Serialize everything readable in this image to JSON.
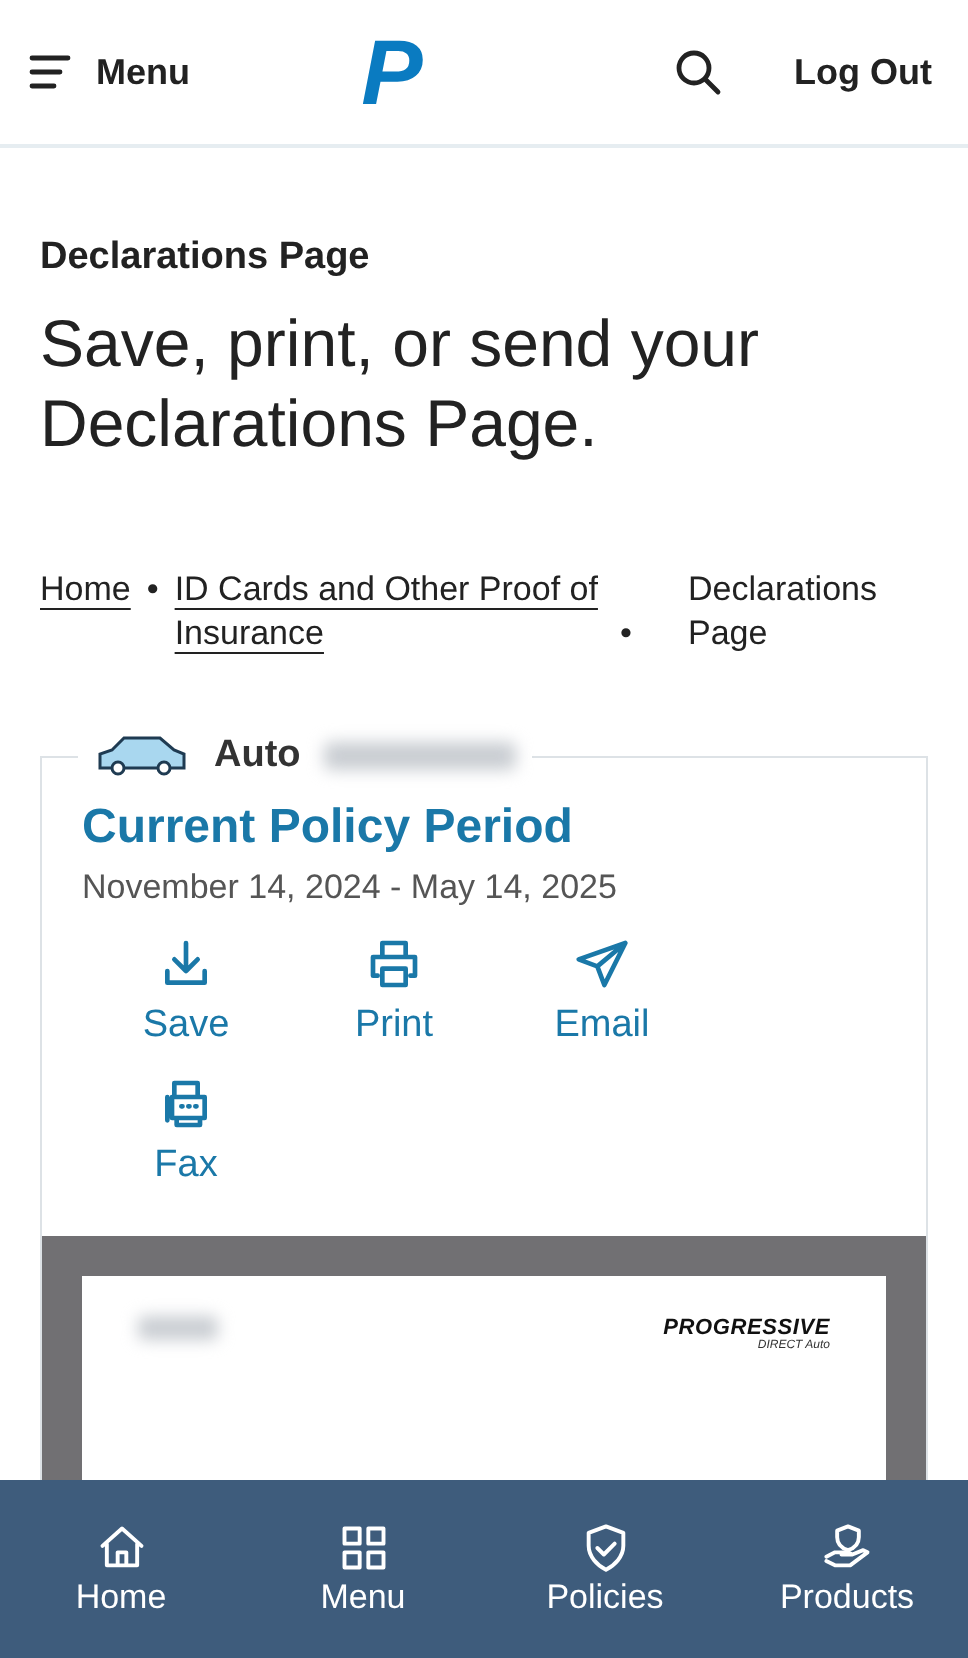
{
  "header": {
    "menu_label": "Menu",
    "logo": "P",
    "logout_label": "Log Out"
  },
  "page": {
    "eyebrow": "Declarations Page",
    "heading": "Save, print, or send your Declarations Page."
  },
  "breadcrumb": [
    {
      "label": "Home",
      "kind": "link",
      "separator": "•"
    },
    {
      "label": "ID Cards and Other Proof of Insurance",
      "kind": "link",
      "separator": "•"
    },
    {
      "label": "Declarations Page",
      "kind": "current"
    }
  ],
  "policy_card": {
    "type": "Auto",
    "title": "Current Policy Period",
    "period": "November 14, 2024 - May 14, 2025",
    "actions": [
      {
        "label": "Save",
        "kind": "download"
      },
      {
        "label": "Print",
        "kind": "print"
      },
      {
        "label": "Email",
        "kind": "send"
      },
      {
        "label": "Fax",
        "kind": "fax"
      }
    ],
    "document_preview": {
      "brand": "PROGRESSIVE",
      "brand_sub": "DIRECT Auto"
    }
  },
  "bottom_nav": [
    {
      "label": "Home",
      "kind": "home"
    },
    {
      "label": "Menu",
      "kind": "grid"
    },
    {
      "label": "Policies",
      "kind": "shield"
    },
    {
      "label": "Products",
      "kind": "hand"
    }
  ]
}
